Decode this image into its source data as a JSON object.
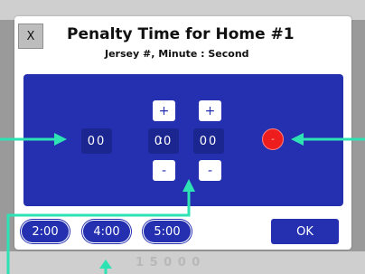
{
  "backdrop": {
    "faded_text": "1 5 0 0 0"
  },
  "dialog": {
    "close_label": "X",
    "title": "Penalty Time for Home #1",
    "subtitle": "Jersey #, Minute : Second"
  },
  "fields": {
    "jersey": "00",
    "minute": "00",
    "separator": ":",
    "second": "00"
  },
  "steppers": {
    "minute_plus": "+",
    "second_plus": "+",
    "minute_minus": "-",
    "second_minus": "-"
  },
  "red_button_label": "-",
  "quick_times": [
    "2:00",
    "4:00",
    "5:00"
  ],
  "ok_label": "OK",
  "colors": {
    "panel": "#2430b0",
    "field": "#1c2690",
    "red_button": "#ee1d1d",
    "annotation": "#2de3b4",
    "dialog": "#ffffff"
  }
}
